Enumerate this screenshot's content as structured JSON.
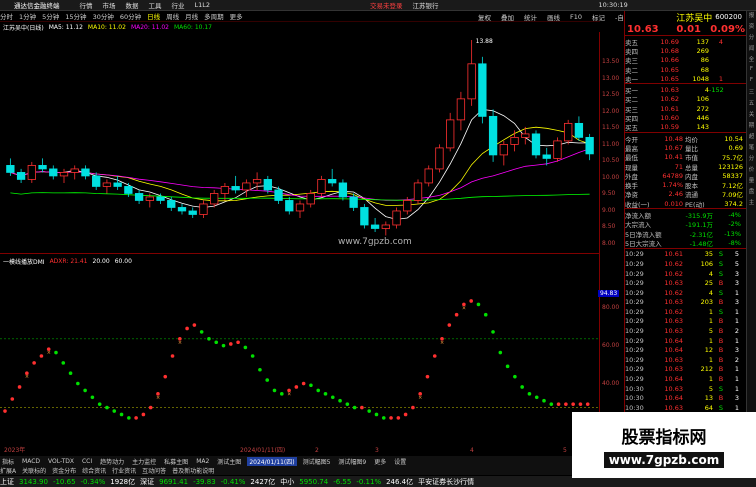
{
  "app": {
    "title": "通达信金融终端"
  },
  "menu": [
    "行情",
    "市场",
    "数据",
    "工具",
    "行业",
    "L1L2"
  ],
  "menu_right": [
    "交易未登录",
    "江苏银行"
  ],
  "clock": "10:30:19",
  "periods": [
    {
      "label": "分时",
      "sel": false
    },
    {
      "label": "1分钟",
      "sel": false
    },
    {
      "label": "5分钟",
      "sel": false
    },
    {
      "label": "15分钟",
      "sel": false
    },
    {
      "label": "30分钟",
      "sel": false
    },
    {
      "label": "60分钟",
      "sel": false
    },
    {
      "label": "日线",
      "sel": true
    },
    {
      "label": "周线",
      "sel": false
    },
    {
      "label": "月线",
      "sel": false
    },
    {
      "label": "多周期",
      "sel": false
    },
    {
      "label": "更多",
      "sel": false
    }
  ],
  "tools": [
    "复权",
    "叠加",
    "统计",
    "画线",
    "F10",
    "标记",
    "-自选",
    "返回"
  ],
  "ma_info": {
    "name": "江苏吴中(日线)",
    "ma5": "MA5: 11.12",
    "ma10": "MA10: 11.02",
    "ma20": "MA20: 11.02",
    "ma60": "MA60: 10.17"
  },
  "ind_info": {
    "name": "一模线播放DMI",
    "adxr": "ADXR: 21.41",
    "v1": "20.00",
    "v2": "60.00"
  },
  "site_text": "www.7gpzb.com",
  "y_main": [
    "13.50",
    "13.00",
    "12.50",
    "12.00",
    "11.50",
    "11.00",
    "10.50",
    "10.00",
    "9.50",
    "9.00",
    "8.50",
    "8.00"
  ],
  "y_ind": [
    "80.00",
    "60.00",
    "40.00",
    "20.00"
  ],
  "y_ind_marker": "94.83",
  "high_label": "13.88",
  "x_labels": {
    "y2023": "2023年",
    "jan": "2024/01/11(四)",
    "m2": "2",
    "m3": "3",
    "m4": "4",
    "m5": "5"
  },
  "stock": {
    "name": "江苏吴中",
    "code": "600200",
    "price": "10.63",
    "change": "0.01",
    "pct": "0.09%"
  },
  "asks": [
    {
      "l": "卖五",
      "p": "10.69",
      "v": "137",
      "d": "4"
    },
    {
      "l": "卖四",
      "p": "10.68",
      "v": "269",
      "d": ""
    },
    {
      "l": "卖三",
      "p": "10.66",
      "v": "86",
      "d": ""
    },
    {
      "l": "卖二",
      "p": "10.65",
      "v": "68",
      "d": ""
    },
    {
      "l": "卖一",
      "p": "10.65",
      "v": "1048",
      "d": "1"
    }
  ],
  "bids": [
    {
      "l": "买一",
      "p": "10.63",
      "v": "4",
      "d": "-152"
    },
    {
      "l": "买二",
      "p": "10.62",
      "v": "106",
      "d": ""
    },
    {
      "l": "买三",
      "p": "10.61",
      "v": "272",
      "d": ""
    },
    {
      "l": "买四",
      "p": "10.60",
      "v": "446",
      "d": ""
    },
    {
      "l": "买五",
      "p": "10.59",
      "v": "143",
      "d": ""
    }
  ],
  "quote": [
    {
      "k": "今开",
      "v": "10.48",
      "k2": "均价",
      "v2": "10.54"
    },
    {
      "k": "最高",
      "v": "10.67",
      "k2": "量比",
      "v2": "0.69"
    },
    {
      "k": "最低",
      "v": "10.41",
      "k2": "市值",
      "v2": "75.7亿"
    },
    {
      "k": "现量",
      "v": "71",
      "k2": "总量",
      "v2": "123126"
    },
    {
      "k": "外盘",
      "v": "64789",
      "k2": "内盘",
      "v2": "58337"
    },
    {
      "k": "换手",
      "v": "1.74%",
      "k2": "股本",
      "v2": "7.12亿"
    },
    {
      "k": "净资",
      "v": "2.46",
      "k2": "流通",
      "v2": "7.09亿"
    },
    {
      "k": "收益(一)",
      "v": "0.010",
      "k2": "PE(动)",
      "v2": "374.2"
    }
  ],
  "flows": [
    {
      "k": "净流入额",
      "v": "-315.9万",
      "p": "-4%"
    },
    {
      "k": "大宗流入",
      "v": "-191.1万",
      "p": "-2%"
    },
    {
      "k": "5日净流入额",
      "v": "-2.31亿",
      "p": "-13%"
    },
    {
      "k": "5日大宗流入",
      "v": "-1.48亿",
      "p": "-8%"
    }
  ],
  "ticks": [
    {
      "t": "10:29",
      "p": "10.61",
      "v": "35",
      "s": "S",
      "n": "5"
    },
    {
      "t": "10:29",
      "p": "10.62",
      "v": "106",
      "s": "S",
      "n": "5"
    },
    {
      "t": "10:29",
      "p": "10.62",
      "v": "4",
      "s": "S",
      "n": "3"
    },
    {
      "t": "10:29",
      "p": "10.63",
      "v": "25",
      "s": "B",
      "n": "3"
    },
    {
      "t": "10:29",
      "p": "10.62",
      "v": "4",
      "s": "S",
      "n": "1"
    },
    {
      "t": "10:29",
      "p": "10.63",
      "v": "203",
      "s": "B",
      "n": "3"
    },
    {
      "t": "10:29",
      "p": "10.62",
      "v": "1",
      "s": "S",
      "n": "1"
    },
    {
      "t": "10:29",
      "p": "10.63",
      "v": "1",
      "s": "B",
      "n": "1"
    },
    {
      "t": "10:29",
      "p": "10.63",
      "v": "5",
      "s": "B",
      "n": "2"
    },
    {
      "t": "10:29",
      "p": "10.64",
      "v": "1",
      "s": "B",
      "n": "1"
    },
    {
      "t": "10:29",
      "p": "10.64",
      "v": "12",
      "s": "B",
      "n": "3"
    },
    {
      "t": "10:29",
      "p": "10.63",
      "v": "1",
      "s": "B",
      "n": "2"
    },
    {
      "t": "10:29",
      "p": "10.63",
      "v": "212",
      "s": "B",
      "n": "1"
    },
    {
      "t": "10:29",
      "p": "10.64",
      "v": "1",
      "s": "B",
      "n": "1"
    },
    {
      "t": "10:30",
      "p": "10.63",
      "v": "5",
      "s": "S",
      "n": "1"
    },
    {
      "t": "10:30",
      "p": "10.64",
      "v": "13",
      "s": "B",
      "n": "3"
    },
    {
      "t": "10:30",
      "p": "10.63",
      "v": "64",
      "s": "S",
      "n": "1"
    },
    {
      "t": "10:30",
      "p": "10.63",
      "v": "6",
      "s": "S",
      "n": "1"
    },
    {
      "t": "10:30",
      "p": "10.63",
      "v": "8",
      "s": "B",
      "n": "1"
    },
    {
      "t": "10:30",
      "p": "10.63",
      "v": "4",
      "s": "S",
      "n": "1"
    }
  ],
  "rside": [
    "报",
    "资",
    "分",
    "闻",
    "全",
    "F",
    "F",
    "三",
    "五",
    "关",
    "期",
    "超",
    "笔",
    "分",
    "价",
    "量",
    "盘",
    "主"
  ],
  "bottom_tabs": [
    "指标",
    "MACD",
    "VOL-TDX",
    "CCI",
    "趋势动力",
    "主力监控",
    "私募主图",
    "MA2",
    "测试主图",
    "2024/01/11(四)",
    "测试幅图5",
    "测试幅图9",
    "更多",
    "设置"
  ],
  "bottom_tabs2": [
    "扩展A",
    "关联标的",
    "资金分布",
    "综合资讯",
    "行业资讯",
    "互动问答",
    "普及新功能说明"
  ],
  "status": [
    {
      "t": "上证",
      "c": "white"
    },
    {
      "t": "3143.90",
      "c": "green"
    },
    {
      "t": "-10.65",
      "c": "green"
    },
    {
      "t": "-0.34%",
      "c": "green"
    },
    {
      "t": "1928亿",
      "c": "white"
    },
    {
      "t": "深证",
      "c": "white"
    },
    {
      "t": "9691.41",
      "c": "green"
    },
    {
      "t": "-39.83",
      "c": "green"
    },
    {
      "t": "-0.41%",
      "c": "green"
    },
    {
      "t": "2427亿",
      "c": "white"
    },
    {
      "t": "中小",
      "c": "white"
    },
    {
      "t": "5950.74",
      "c": "green"
    },
    {
      "t": "-6.55",
      "c": "green"
    },
    {
      "t": "-0.11%",
      "c": "green"
    },
    {
      "t": "246.4亿",
      "c": "white"
    },
    {
      "t": "平安证券长沙行情",
      "c": "white"
    }
  ],
  "watermark": {
    "title": "股票指标网",
    "url": "www.7gpzb.com"
  },
  "chart_data": [
    {
      "type": "candlestick",
      "title": "",
      "ylim": [
        8.0,
        13.88
      ],
      "series": [
        {
          "name": "MA5",
          "color": "#ffffff"
        },
        {
          "name": "MA10",
          "color": "#ffff00"
        },
        {
          "name": "MA20",
          "color": "#ff00ff"
        },
        {
          "name": "MA60",
          "color": "#00ff00"
        }
      ],
      "ohlc": [
        [
          10.3,
          10.5,
          10.0,
          10.1
        ],
        [
          10.1,
          10.2,
          9.8,
          9.9
        ],
        [
          9.9,
          10.4,
          9.8,
          10.3
        ],
        [
          10.3,
          10.5,
          10.1,
          10.2
        ],
        [
          10.2,
          10.3,
          9.9,
          10.0
        ],
        [
          10.0,
          10.2,
          9.8,
          10.1
        ],
        [
          10.1,
          10.3,
          9.9,
          10.2
        ],
        [
          10.2,
          10.3,
          9.9,
          10.0
        ],
        [
          10.0,
          10.1,
          9.6,
          9.7
        ],
        [
          9.7,
          9.9,
          9.5,
          9.8
        ],
        [
          9.8,
          10.0,
          9.6,
          9.7
        ],
        [
          9.7,
          9.8,
          9.4,
          9.5
        ],
        [
          9.5,
          9.6,
          9.2,
          9.3
        ],
        [
          9.3,
          9.5,
          9.1,
          9.4
        ],
        [
          9.4,
          9.5,
          9.2,
          9.3
        ],
        [
          9.3,
          9.4,
          9.0,
          9.1
        ],
        [
          9.1,
          9.2,
          8.9,
          9.0
        ],
        [
          9.0,
          9.1,
          8.8,
          8.9
        ],
        [
          8.9,
          9.3,
          8.8,
          9.2
        ],
        [
          9.2,
          9.6,
          9.1,
          9.5
        ],
        [
          9.5,
          9.8,
          9.3,
          9.7
        ],
        [
          9.7,
          10.0,
          9.5,
          9.6
        ],
        [
          9.6,
          9.9,
          9.4,
          9.8
        ],
        [
          9.8,
          10.1,
          9.6,
          9.9
        ],
        [
          9.9,
          10.0,
          9.5,
          9.6
        ],
        [
          9.6,
          9.7,
          9.2,
          9.3
        ],
        [
          9.3,
          9.4,
          8.9,
          9.0
        ],
        [
          9.0,
          9.3,
          8.8,
          9.2
        ],
        [
          9.2,
          9.6,
          9.1,
          9.5
        ],
        [
          9.5,
          10.0,
          9.4,
          9.9
        ],
        [
          9.9,
          10.2,
          9.7,
          9.8
        ],
        [
          9.8,
          9.9,
          9.3,
          9.4
        ],
        [
          9.4,
          9.5,
          9.0,
          9.1
        ],
        [
          9.1,
          9.2,
          8.5,
          8.6
        ],
        [
          8.6,
          8.8,
          8.4,
          8.5
        ],
        [
          8.5,
          8.7,
          8.3,
          8.6
        ],
        [
          8.6,
          9.1,
          8.5,
          9.0
        ],
        [
          9.0,
          9.4,
          8.9,
          9.3
        ],
        [
          9.3,
          9.9,
          9.2,
          9.8
        ],
        [
          9.8,
          10.3,
          9.7,
          10.2
        ],
        [
          10.2,
          10.9,
          10.1,
          10.8
        ],
        [
          10.8,
          11.8,
          10.7,
          11.6
        ],
        [
          11.6,
          12.4,
          11.3,
          12.2
        ],
        [
          12.2,
          13.88,
          12.0,
          13.2
        ],
        [
          13.2,
          13.4,
          11.5,
          11.7
        ],
        [
          11.7,
          11.9,
          10.4,
          10.6
        ],
        [
          10.6,
          11.0,
          10.3,
          10.9
        ],
        [
          10.9,
          11.3,
          10.7,
          11.1
        ],
        [
          11.1,
          11.4,
          10.9,
          11.2
        ],
        [
          11.2,
          11.3,
          10.5,
          10.6
        ],
        [
          10.6,
          10.8,
          10.3,
          10.5
        ],
        [
          10.5,
          11.1,
          10.4,
          11.0
        ],
        [
          11.0,
          11.6,
          10.9,
          11.5
        ],
        [
          11.5,
          11.7,
          11.0,
          11.1
        ],
        [
          11.1,
          11.2,
          10.45,
          10.63
        ]
      ]
    },
    {
      "type": "scatter",
      "title": "",
      "ylim": [
        0,
        100
      ],
      "series": [
        {
          "name": "ADXR",
          "color": "#ff3030"
        }
      ],
      "values": [
        18,
        25,
        32,
        40,
        46,
        50,
        54,
        52,
        46,
        40,
        34,
        30,
        26,
        22,
        20,
        18,
        16,
        14,
        14,
        16,
        20,
        28,
        38,
        50,
        60,
        66,
        68,
        64,
        60,
        58,
        56,
        57,
        58,
        55,
        50,
        42,
        36,
        30,
        28,
        30,
        32,
        34,
        33,
        30,
        28,
        26,
        24,
        22,
        20,
        20,
        18,
        16,
        14,
        14,
        14,
        16,
        20,
        28,
        38,
        50,
        60,
        68,
        74,
        80,
        82,
        80,
        74,
        64,
        52,
        44,
        38,
        32,
        28,
        26,
        24,
        22,
        22,
        22,
        22,
        22,
        22
      ]
    }
  ]
}
